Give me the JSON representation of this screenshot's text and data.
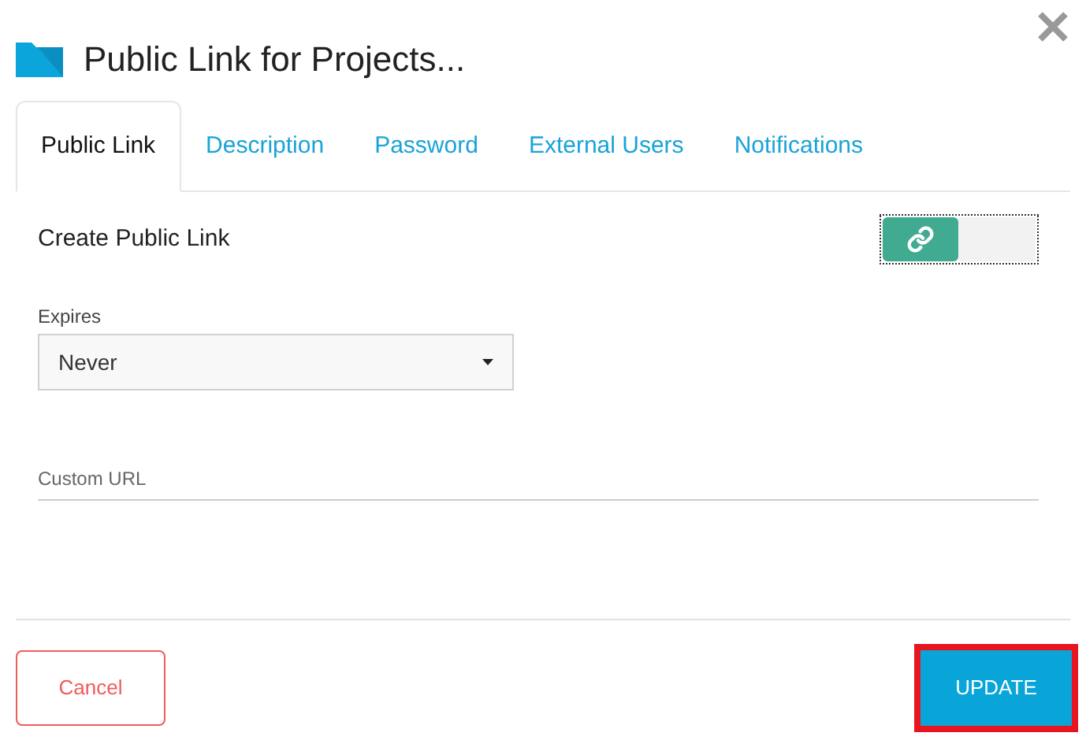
{
  "dialog": {
    "title": "Public Link for Projects..."
  },
  "tabs": [
    {
      "label": "Public Link",
      "selected": true
    },
    {
      "label": "Description",
      "selected": false
    },
    {
      "label": "Password",
      "selected": false
    },
    {
      "label": "External Users",
      "selected": false
    },
    {
      "label": "Notifications",
      "selected": false
    }
  ],
  "create_public_link": {
    "label": "Create Public Link",
    "on": true
  },
  "expires": {
    "label": "Expires",
    "value": "Never"
  },
  "custom_url": {
    "placeholder": "Custom URL"
  },
  "buttons": {
    "cancel": "Cancel",
    "update": {
      "label": "UPDATE",
      "highlighted": true
    }
  }
}
